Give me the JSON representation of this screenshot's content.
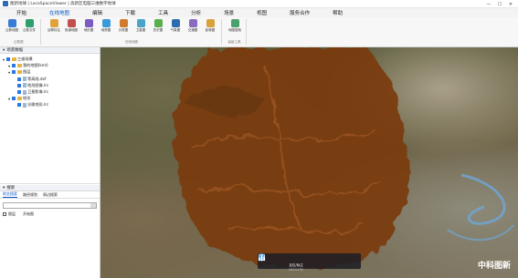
{
  "window": {
    "title": "图新地球 | LocaSpaceViewer | 高新区电脑三维数字地球"
  },
  "menu": [
    "开始",
    "在线地图",
    "编辑",
    "下载",
    "工具",
    "分析",
    "场景",
    "视图",
    "服务合作",
    "帮助"
  ],
  "ribbon": {
    "groups": [
      {
        "label": "云数据",
        "buttons": [
          "云数地图",
          "云数文件"
        ]
      },
      {
        "label": "在线地图",
        "buttons": [
          "谷歌标注",
          "街道地图",
          "地形图",
          "地势图",
          "分类图",
          "卫星图",
          "历史图",
          "气象图",
          "交通图",
          "影像图"
        ]
      },
      {
        "label": "高级工具",
        "buttons": [
          "地图搜索"
        ]
      }
    ]
  },
  "sidebar": {
    "layers_title": "场景数据",
    "tree": [
      {
        "label": "三维场景",
        "level": 0,
        "checked": true,
        "kind": "folder"
      },
      {
        "label": "我的地图(kml)",
        "level": 1,
        "checked": true,
        "kind": "folder"
      },
      {
        "label": "图层",
        "level": 1,
        "checked": true,
        "kind": "folder"
      },
      {
        "label": "等高线.dxf",
        "level": 2,
        "checked": true,
        "kind": "file"
      },
      {
        "label": "地形图像.lrc",
        "level": 2,
        "checked": true,
        "kind": "file"
      },
      {
        "label": "卫星影像.lrc",
        "level": 2,
        "checked": true,
        "kind": "file"
      },
      {
        "label": "地形",
        "level": 1,
        "checked": true,
        "kind": "folder"
      },
      {
        "label": "谷歌地形.lrc",
        "level": 2,
        "checked": true,
        "kind": "file"
      }
    ],
    "search": {
      "title": "搜索",
      "tabs": [
        "地名搜索",
        "路径规划",
        "周边搜索"
      ],
      "placeholder": "",
      "filter_label": "图层",
      "filter_option": "开始图"
    }
  },
  "map": {
    "toolbar": [
      "hand-icon",
      "pointer-icon",
      "marker-icon",
      "pen-icon",
      "square-icon",
      "chart-icon"
    ],
    "marker_label": "定位/标注",
    "marker_sub": "0211135",
    "watermark": "中科图新"
  },
  "colors": {
    "overlay": "#7a3b10",
    "accent": "#0a58ca"
  }
}
